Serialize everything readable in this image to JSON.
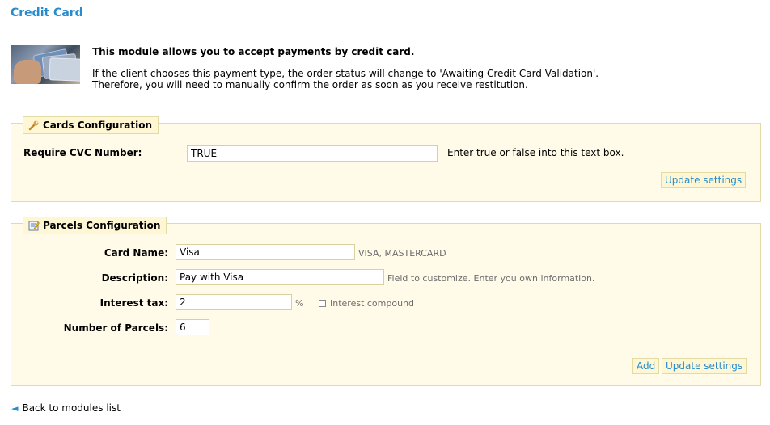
{
  "page": {
    "title": "Credit Card"
  },
  "intro": {
    "heading": "This module allows you to accept payments by credit card.",
    "line1": "If the client chooses this payment type, the order status will change to 'Awaiting Credit Card Validation'.",
    "line2": "Therefore, you will need to manually confirm the order as soon as you receive restitution."
  },
  "cards_config": {
    "legend": "Cards Configuration",
    "cvc_label": "Require CVC Number:",
    "cvc_value": "TRUE",
    "cvc_hint": "Enter true or false into this text box.",
    "update_button": "Update settings"
  },
  "parcels_config": {
    "legend": "Parcels Configuration",
    "card_name_label": "Card Name:",
    "card_name_value": "Visa",
    "card_name_hint": "VISA, MASTERCARD",
    "description_label": "Description:",
    "description_value": "Pay with Visa",
    "description_hint": "Field to customize. Enter you own information.",
    "interest_label": "Interest tax:",
    "interest_value": "2",
    "interest_unit": "%",
    "interest_compound_label": "Interest compound",
    "interest_compound_checked": false,
    "parcels_label": "Number of Parcels:",
    "parcels_value": "6",
    "add_button": "Add",
    "update_button": "Update settings"
  },
  "footer": {
    "back_link": "Back to modules list"
  },
  "colors": {
    "accent": "#268ccd",
    "panel_bg": "#fffbe8",
    "panel_border": "#e3dba4",
    "tab_bg": "#fff6d3"
  },
  "icons": {
    "cards_legend": "wrench-icon",
    "parcels_legend": "edit-note-icon",
    "back": "arrow-left-icon"
  }
}
